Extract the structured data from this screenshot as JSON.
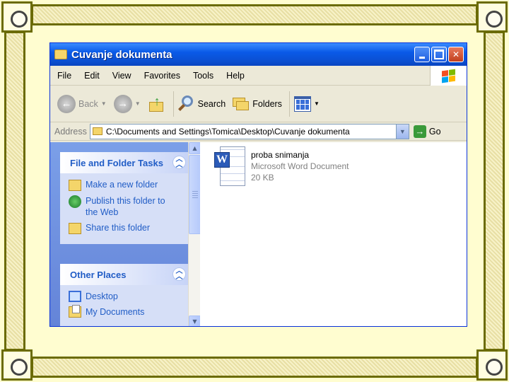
{
  "window": {
    "title": "Cuvanje dokumenta"
  },
  "menubar": {
    "items": [
      "File",
      "Edit",
      "View",
      "Favorites",
      "Tools",
      "Help"
    ]
  },
  "toolbar": {
    "back_label": "Back",
    "search_label": "Search",
    "folders_label": "Folders"
  },
  "address": {
    "label": "Address",
    "path": "C:\\Documents and Settings\\Tomica\\Desktop\\Cuvanje dokumenta",
    "go_label": "Go"
  },
  "taskpane": {
    "file_tasks": {
      "title": "File and Folder Tasks",
      "items": [
        {
          "label": "Make a new folder",
          "icon": "new-folder-icon"
        },
        {
          "label": "Publish this folder to the Web",
          "icon": "globe-icon"
        },
        {
          "label": "Share this folder",
          "icon": "share-folder-icon"
        }
      ]
    },
    "other_places": {
      "title": "Other Places",
      "items": [
        {
          "label": "Desktop",
          "icon": "desktop-icon"
        },
        {
          "label": "My Documents",
          "icon": "my-documents-icon"
        }
      ]
    }
  },
  "files": [
    {
      "name": "proba snimanja",
      "type": "Microsoft Word Document",
      "size": "20 KB",
      "icon": "word-document-icon"
    }
  ],
  "colors": {
    "titlebar": "#0a5ae8",
    "taskpane_link": "#215dc6",
    "frame": "#6b6b00",
    "slide_bg": "#fffdd0"
  }
}
